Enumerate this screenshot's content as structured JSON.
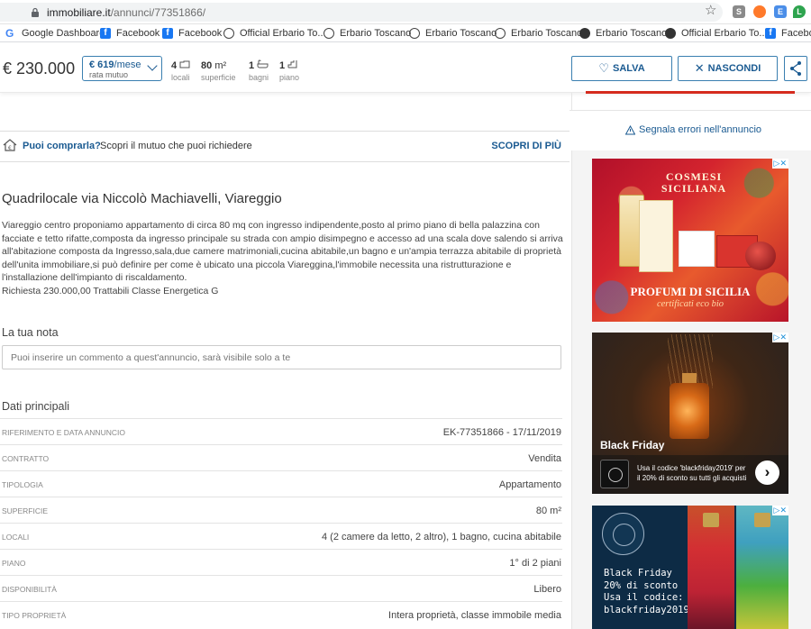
{
  "browser": {
    "url_host": "immobiliare.it",
    "url_path": "/annunci/77351866/",
    "bookmarks": [
      {
        "label": "Google Dashboard",
        "icon": "google-icon"
      },
      {
        "label": "Facebook",
        "icon": "facebook-icon"
      },
      {
        "label": "Facebook",
        "icon": "facebook-icon"
      },
      {
        "label": "Official Erbario To...",
        "icon": "leaf-icon"
      },
      {
        "label": "Erbario Toscano",
        "icon": "leaf-icon"
      },
      {
        "label": "Erbario Toscano",
        "icon": "leaf-icon"
      },
      {
        "label": "Erbario Toscano",
        "icon": "leaf-icon"
      },
      {
        "label": "Erbario Toscano",
        "icon": "globe-icon"
      },
      {
        "label": "Official Erbario To...",
        "icon": "globe-icon"
      },
      {
        "label": "Facebo",
        "icon": "facebook-icon"
      }
    ],
    "extensions": [
      "S",
      "E",
      "L"
    ]
  },
  "header": {
    "price": "€ 230.000",
    "mutuo_value": "€ 619",
    "mutuo_unit": "/mese",
    "mutuo_label": "rata mutuo",
    "features": [
      {
        "value": "4",
        "unit": "",
        "label": "locali",
        "icon": "rooms-icon"
      },
      {
        "value": "80",
        "unit": "m²",
        "label": "superficie",
        "icon": ""
      },
      {
        "value": "1",
        "unit": "",
        "label": "bagni",
        "icon": "bath-icon"
      },
      {
        "value": "1",
        "unit": "",
        "label": "piano",
        "icon": "stairs-icon"
      }
    ],
    "save_label": "SALVA",
    "hide_label": "NASCONDI"
  },
  "mortgage_banner": {
    "question": "Puoi comprarla?",
    "description": "Scopri il mutuo che puoi richiedere",
    "cta": "SCOPRI DI PIÙ"
  },
  "listing": {
    "title": "Quadrilocale via Niccolò Machiavelli, Viareggio",
    "description": "Viareggio centro proponiamo appartamento di circa 80 mq con ingresso indipendente,posto al primo piano di bella palazzina con facciate e tetto rifatte,composta da ingresso principale su strada con ampio disimpegno e accesso ad una scala dove salendo si arriva all'abitazione composta da Ingresso,sala,due camere matrimoniali,cucina abitabile,un bagno e un'ampia terrazza abitabile di proprietà dell'unita immobiliare,si può definire per come è ubicato una piccola Viareggina,l'immobile necessita una ristrutturazione e l'installazione dell'impianto di riscaldamento.",
    "description_2": "Richiesta 230.000,00 Trattabili Classe Energetica G"
  },
  "note": {
    "heading": "La tua nota",
    "placeholder": "Puoi inserire un commento a quest'annuncio, sarà visibile solo a te"
  },
  "details": {
    "heading": "Dati principali",
    "rows": [
      {
        "key": "Riferimento e data annuncio",
        "value": "EK-77351866 - 17/11/2019"
      },
      {
        "key": "Contratto",
        "value": "Vendita"
      },
      {
        "key": "Tipologia",
        "value": "Appartamento"
      },
      {
        "key": "Superficie",
        "value": "80 m²"
      },
      {
        "key": "Locali",
        "value": "4 (2 camere da letto, 2 altro), 1 bagno, cucina abitabile"
      },
      {
        "key": "Piano",
        "value": "1° di 2 piani"
      },
      {
        "key": "Disponibilità",
        "value": "Libero"
      },
      {
        "key": "Tipo proprietà",
        "value": "Intera proprietà, classe immobile media"
      }
    ]
  },
  "sidebar": {
    "report_label": "Segnala errori nell'annuncio",
    "ads": [
      {
        "brand": "COSMESI SICILIANA",
        "headline": "PROFUMI DI SICILIA",
        "tagline": "certificati eco bio"
      },
      {
        "headline": "Black Friday",
        "text": "Usa il codice 'blackfriday2019' per il 20% di sconto su tutti gli acquisti",
        "arrow": "›"
      },
      {
        "text": "Black Friday\n20% di sconto\nUsa il codice:\nblackfriday2019"
      }
    ]
  },
  "colors": {
    "accent": "#1a5a91",
    "border_accent": "#3a7fb0",
    "brand_red": "#d52b1e"
  }
}
